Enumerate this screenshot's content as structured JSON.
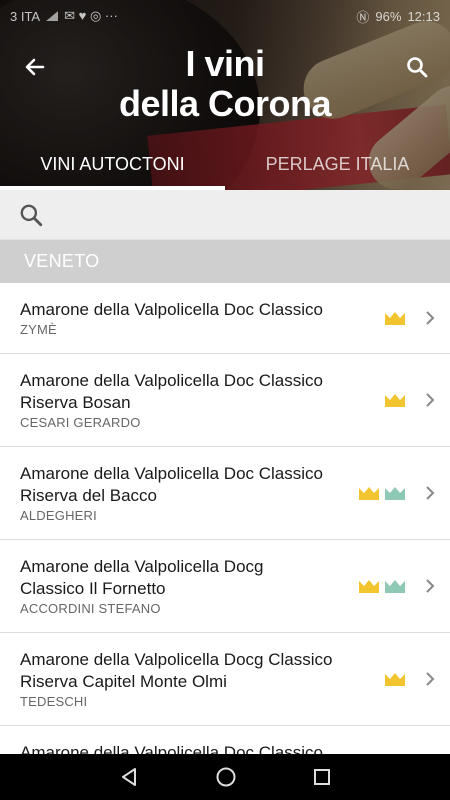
{
  "status_bar": {
    "carrier": "3 ITA",
    "battery": "96%",
    "time": "12:13"
  },
  "header": {
    "title_line1": "I vini",
    "title_line2": "della Corona"
  },
  "tabs": [
    {
      "label": "VINI AUTOCTONI",
      "active": true
    },
    {
      "label": "PERLAGE ITALIA",
      "active": false
    }
  ],
  "search": {
    "placeholder": ""
  },
  "section": {
    "label": "VENETO"
  },
  "wines": [
    {
      "name_line1": "Amarone della Valpolicella Doc Classico",
      "name_line2": "",
      "producer": "ZYMÈ",
      "badges": [
        "gold"
      ]
    },
    {
      "name_line1": "Amarone della Valpolicella Doc Classico",
      "name_line2": "Riserva Bosan",
      "producer": "CESARI GERARDO",
      "badges": [
        "gold"
      ]
    },
    {
      "name_line1": "Amarone della Valpolicella Doc Classico",
      "name_line2": "Riserva del Bacco",
      "producer": "ALDEGHERI",
      "badges": [
        "gold",
        "green"
      ]
    },
    {
      "name_line1": "Amarone della Valpolicella Docg",
      "name_line2": "Classico Il Fornetto",
      "producer": "ACCORDINI STEFANO",
      "badges": [
        "gold",
        "green"
      ]
    },
    {
      "name_line1": "Amarone della Valpolicella Docg Classico",
      "name_line2": "Riserva Capitel Monte Olmi",
      "producer": "TEDESCHI",
      "badges": [
        "gold"
      ]
    },
    {
      "name_line1": "Amarone della Valpolicella Doc Classico",
      "name_line2": "",
      "producer": "",
      "badges": []
    }
  ],
  "colors": {
    "crown_gold": "#f2c530",
    "crown_green": "#8ec9b6",
    "section_bg": "#cfcfcf"
  }
}
